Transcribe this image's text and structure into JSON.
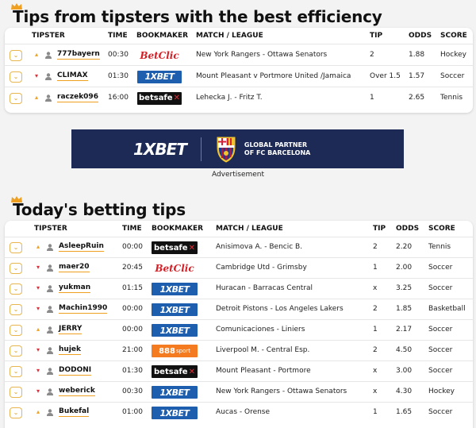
{
  "section1": {
    "title": "Tips from tipsters with the best efficiency",
    "headers": {
      "tipster": "TIPSTER",
      "time": "TIME",
      "bookmaker": "BOOKMAKER",
      "match": "MATCH / LEAGUE",
      "tip": "TIP",
      "odds": "ODDS",
      "score": "SCORE"
    },
    "rows": [
      {
        "trend": "up",
        "tipster": "777bayern",
        "time": "00:30",
        "bookmaker": "betclic",
        "match": "New York Rangers - Ottawa Senators",
        "tip": "2",
        "odds": "1.88",
        "score": "Hockey"
      },
      {
        "trend": "down",
        "tipster": "CLIMAX",
        "time": "01:30",
        "bookmaker": "1xbet",
        "match": "Mount Pleasant v Portmore United /Jamaica",
        "tip": "Over 1.5",
        "odds": "1.57",
        "score": "Soccer"
      },
      {
        "trend": "up",
        "tipster": "raczek096",
        "time": "16:00",
        "bookmaker": "betsafe",
        "match": "Lehecka J. - Fritz T.",
        "tip": "1",
        "odds": "2.65",
        "score": "Tennis"
      }
    ]
  },
  "banner": {
    "brand": "1XBET",
    "line1": "GLOBAL PARTNER",
    "line2": "OF FC BARCELONA",
    "advert_label": "Advertisement"
  },
  "section2": {
    "title": "Today's betting tips",
    "headers": {
      "tipster": "TIPSTER",
      "time": "TIME",
      "bookmaker": "BOOKMAKER",
      "match": "MATCH / LEAGUE",
      "tip": "TIP",
      "odds": "ODDS",
      "score": "SCORE"
    },
    "rows": [
      {
        "trend": "up",
        "tipster": "AsleepRuin",
        "time": "00:00",
        "bookmaker": "betsafe",
        "match": "Anisimova A. - Bencic B.",
        "tip": "2",
        "odds": "2.20",
        "score": "Tennis"
      },
      {
        "trend": "down",
        "tipster": "maer20",
        "time": "20:45",
        "bookmaker": "betclic",
        "match": "Cambridge Utd - Grimsby",
        "tip": "1",
        "odds": "2.00",
        "score": "Soccer"
      },
      {
        "trend": "down",
        "tipster": "yukman",
        "time": "01:15",
        "bookmaker": "1xbet",
        "match": "Huracan - Barracas Central",
        "tip": "x",
        "odds": "3.25",
        "score": "Soccer"
      },
      {
        "trend": "down",
        "tipster": "Machin1990",
        "time": "00:00",
        "bookmaker": "1xbet",
        "match": "Detroit Pistons - Los Angeles Lakers",
        "tip": "2",
        "odds": "1.85",
        "score": "Basketball"
      },
      {
        "trend": "up",
        "tipster": "JERRY",
        "time": "00:00",
        "bookmaker": "1xbet",
        "match": "Comunicaciones - Liniers",
        "tip": "1",
        "odds": "2.17",
        "score": "Soccer"
      },
      {
        "trend": "down",
        "tipster": "hujek",
        "time": "21:00",
        "bookmaker": "888",
        "match": "Liverpool M. - Central Esp.",
        "tip": "2",
        "odds": "4.50",
        "score": "Soccer"
      },
      {
        "trend": "down",
        "tipster": "DODONI",
        "time": "01:30",
        "bookmaker": "betsafe",
        "match": "Mount Pleasant - Portmore",
        "tip": "x",
        "odds": "3.00",
        "score": "Soccer"
      },
      {
        "trend": "down",
        "tipster": "weberick",
        "time": "00:30",
        "bookmaker": "1xbet",
        "match": "New York Rangers - Ottawa Senators",
        "tip": "x",
        "odds": "4.30",
        "score": "Hockey"
      },
      {
        "trend": "up",
        "tipster": "Bukefal",
        "time": "01:00",
        "bookmaker": "1xbet",
        "match": "Aucas - Orense",
        "tip": "1",
        "odds": "1.65",
        "score": "Soccer"
      }
    ]
  },
  "bookmakers": {
    "1xbet": {
      "text": "1XBET",
      "color": "#1d5fae"
    },
    "betsafe": {
      "text": "betsafe",
      "color": "#111111"
    },
    "betclic": {
      "text": "BetClic",
      "color": "#d51f26"
    },
    "888": {
      "text": "888",
      "sub": "sport",
      "color": "#f47b20"
    }
  },
  "icons": {
    "crown": "crown-icon",
    "expand": "chevron-down-icon",
    "user": "user-icon",
    "trend_up": "arrow-up-icon",
    "trend_down": "arrow-down-icon"
  },
  "colors": {
    "accent": "#f0a020",
    "down": "#e0303a"
  }
}
